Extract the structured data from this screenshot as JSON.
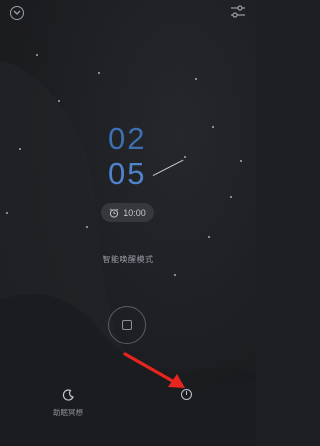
{
  "clock": {
    "hour": "02",
    "minute": "05"
  },
  "alarm": {
    "time": "10:00"
  },
  "mode_label": "智能唤醒模式",
  "bottom": {
    "sleep_label": "助眠冥想"
  },
  "colors": {
    "hour": "#3d6fb2",
    "minute": "#4f84cc",
    "arrow": "#e8241f",
    "background": "#1d1e21"
  },
  "icons": [
    "chevron-down-icon",
    "settings-sliders-icon",
    "alarm-clock-icon",
    "stop-icon",
    "moon-icon",
    "power-icon",
    "annotation-arrow"
  ]
}
